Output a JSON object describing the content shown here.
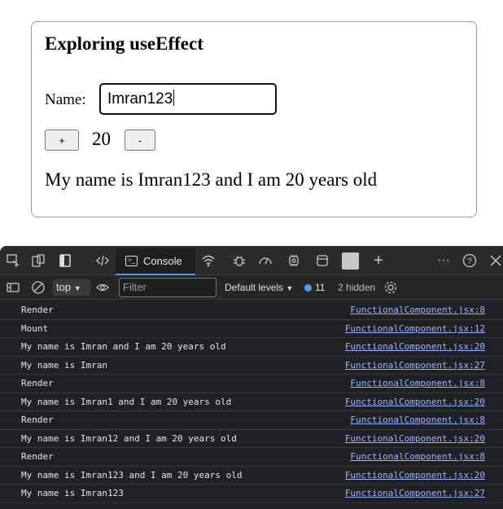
{
  "app": {
    "title": "Exploring useEffect",
    "name_label": "Name:",
    "name_value": "Imran123",
    "plus_label": "+",
    "minus_label": "-",
    "count": "20",
    "message": "My name is Imran123 and I am 20 years old"
  },
  "devtools": {
    "tabs": {
      "console_label": "Console"
    },
    "filterbar": {
      "context": "top",
      "filter_placeholder": "Filter",
      "levels": "Default levels",
      "issues_count": "11",
      "hidden": "2 hidden"
    },
    "logs": [
      {
        "message": "Render",
        "source": "FunctionalComponent.jsx:8"
      },
      {
        "message": "Mount",
        "source": "FunctionalComponent.jsx:12"
      },
      {
        "message": "My name is Imran and I am 20 years old",
        "source": "FunctionalComponent.jsx:20"
      },
      {
        "message": "My name is Imran",
        "source": "FunctionalComponent.jsx:27"
      },
      {
        "message": "Render",
        "source": "FunctionalComponent.jsx:8"
      },
      {
        "message": "My name is Imran1 and I am 20 years old",
        "source": "FunctionalComponent.jsx:20"
      },
      {
        "message": "Render",
        "source": "FunctionalComponent.jsx:8"
      },
      {
        "message": "My name is Imran12 and I am 20 years old",
        "source": "FunctionalComponent.jsx:20"
      },
      {
        "message": "Render",
        "source": "FunctionalComponent.jsx:8"
      },
      {
        "message": "My name is Imran123 and I am 20 years old",
        "source": "FunctionalComponent.jsx:20"
      },
      {
        "message": "My name is Imran123",
        "source": "FunctionalComponent.jsx:27"
      }
    ],
    "icons": [
      "inspect-icon",
      "device-toggle-icon",
      "dock-icon",
      "elements-icon",
      "console-icon",
      "network-icon",
      "sources-bug-icon",
      "performance-icon",
      "settings-gear-icon",
      "application-icon",
      "add-tab-icon",
      "more-icon",
      "help-icon",
      "close-icon",
      "sidebar-icon",
      "clear-console-icon",
      "eye-icon",
      "issues-icon",
      "settings-icon"
    ]
  }
}
